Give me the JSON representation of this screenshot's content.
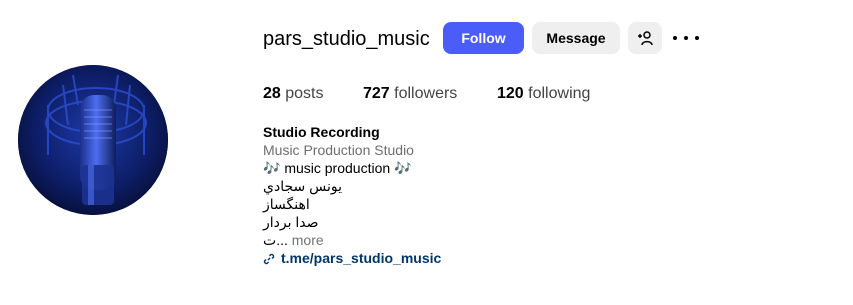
{
  "profile": {
    "username": "pars_studio_music",
    "follow_label": "Follow",
    "message_label": "Message",
    "add_user_icon": "person-add-icon",
    "more_icon": "more-horizontal-icon"
  },
  "stats": {
    "posts_count": "28",
    "posts_label": "posts",
    "followers_count": "727",
    "followers_label": "followers",
    "following_count": "120",
    "following_label": "following"
  },
  "bio": {
    "name": "Studio Recording",
    "category": "Music Production Studio",
    "line1": "🎶 music production 🎶",
    "line2": "يونس سجادي",
    "line3": "اهنگساز",
    "line4": "صدا بردار",
    "line5_prefix": "ت...",
    "more_label": "more",
    "link_text": "t.me/pars_studio_music",
    "link_icon": "link-icon"
  },
  "colors": {
    "follow_button": "#4a5df9",
    "secondary_button": "#efefef",
    "link": "#00376b",
    "muted": "#737373",
    "avatar_bg": "#0a1540"
  }
}
